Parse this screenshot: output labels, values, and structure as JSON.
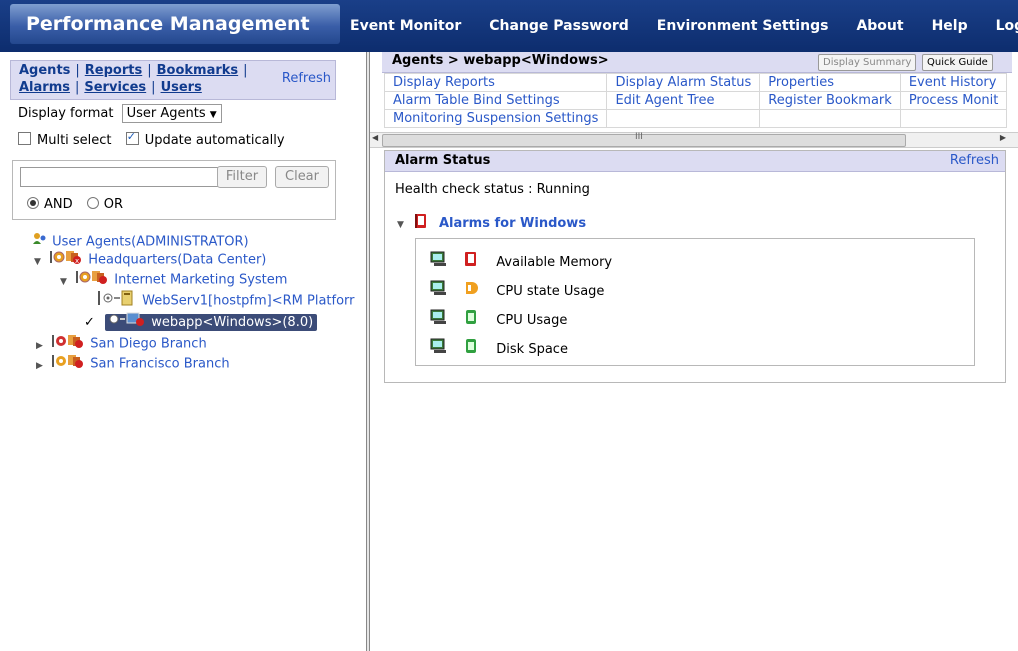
{
  "header": {
    "title": "Performance Management",
    "nav": [
      "Event Monitor",
      "Change Password",
      "Environment Settings",
      "About",
      "Help",
      "Logout"
    ]
  },
  "left": {
    "menu": {
      "row1": [
        "Agents",
        "Reports",
        "Bookmarks"
      ],
      "row2": [
        "Alarms",
        "Services",
        "Users"
      ],
      "refresh": "Refresh"
    },
    "display_format_label": "Display format",
    "display_format_value": "User Agents",
    "multi_select_label": "Multi select",
    "update_auto_label": "Update automatically",
    "filter_button": "Filter",
    "clear_button": "Clear",
    "and_label": "AND",
    "or_label": "OR",
    "tree": {
      "root": "User Agents(ADMINISTRATOR)",
      "hq": "Headquarters(Data Center)",
      "ims": "Internet Marketing System",
      "webserv": "WebServ1[hostpfm]<RM Platforr",
      "webapp": "webapp<Windows>(8.0)",
      "sandiego": "San Diego Branch",
      "sanfran": "San Francisco Branch"
    }
  },
  "right": {
    "breadcrumb": "Agents > webapp<Windows>",
    "display_summary": "Display Summary",
    "quick_guide": "Quick Guide",
    "links": [
      [
        "Display Reports",
        "Display Alarm Status",
        "Properties",
        "Event History"
      ],
      [
        "Alarm Table Bind Settings",
        "Edit Agent Tree",
        "Register Bookmark",
        "Process Monit"
      ],
      [
        "Monitoring Suspension Settings",
        "",
        "",
        ""
      ]
    ],
    "scroll_grip": "III",
    "alarm_status": {
      "title": "Alarm Status",
      "refresh": "Refresh",
      "health": "Health check status : Running",
      "group": "Alarms for Windows",
      "alarms": [
        {
          "label": "Available Memory",
          "status": "red"
        },
        {
          "label": "CPU state Usage",
          "status": "orange"
        },
        {
          "label": "CPU Usage",
          "status": "green"
        },
        {
          "label": "Disk Space",
          "status": "green"
        }
      ]
    }
  },
  "colors": {
    "header_bg": "#0d2d6e",
    "panel_header": "#dcdcf2",
    "link": "#2a58c8",
    "selected": "#3c4c78"
  }
}
